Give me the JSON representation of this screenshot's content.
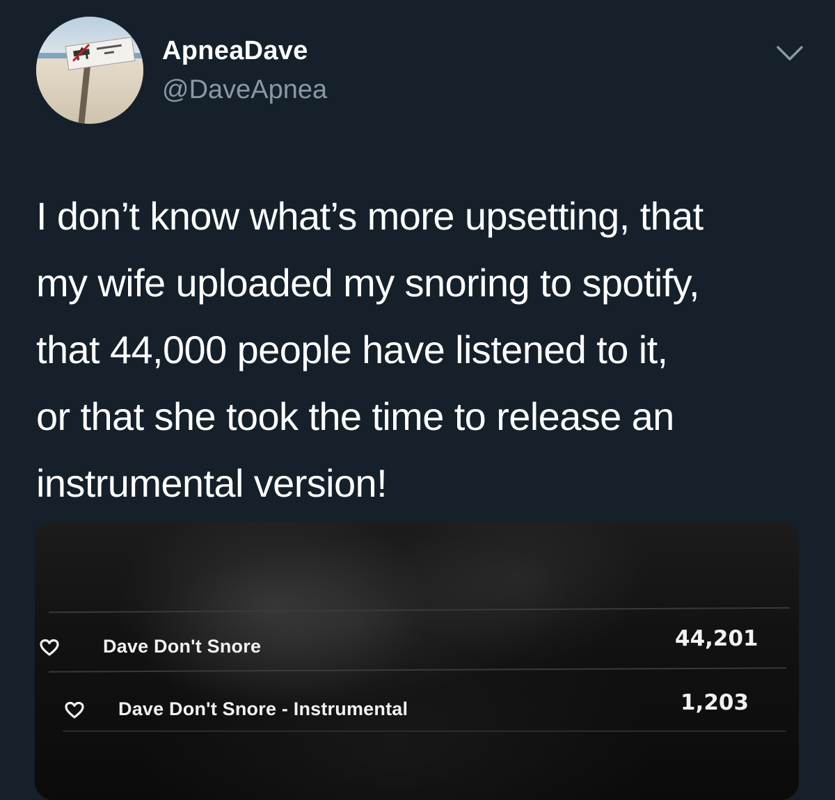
{
  "author": {
    "display_name": "ApneaDave",
    "handle": "@DaveApnea"
  },
  "tweet": {
    "lines": [
      "I don’t know what’s more upsetting, that",
      "my wife uploaded my snoring to spotify,",
      "that 44,000 people have listened to it,",
      "or that she took the time to release an",
      "instrumental version!"
    ]
  },
  "icons": {
    "caret": "chevron-down-icon",
    "like": "heart-outline-icon"
  },
  "colors": {
    "background": "#15202b",
    "secondary_text": "#8899a6"
  },
  "tracks": [
    {
      "title": "Dave Don't Snore",
      "plays": "44,201"
    },
    {
      "title": "Dave Don't Snore - Instrumental",
      "plays": "1,203"
    }
  ]
}
